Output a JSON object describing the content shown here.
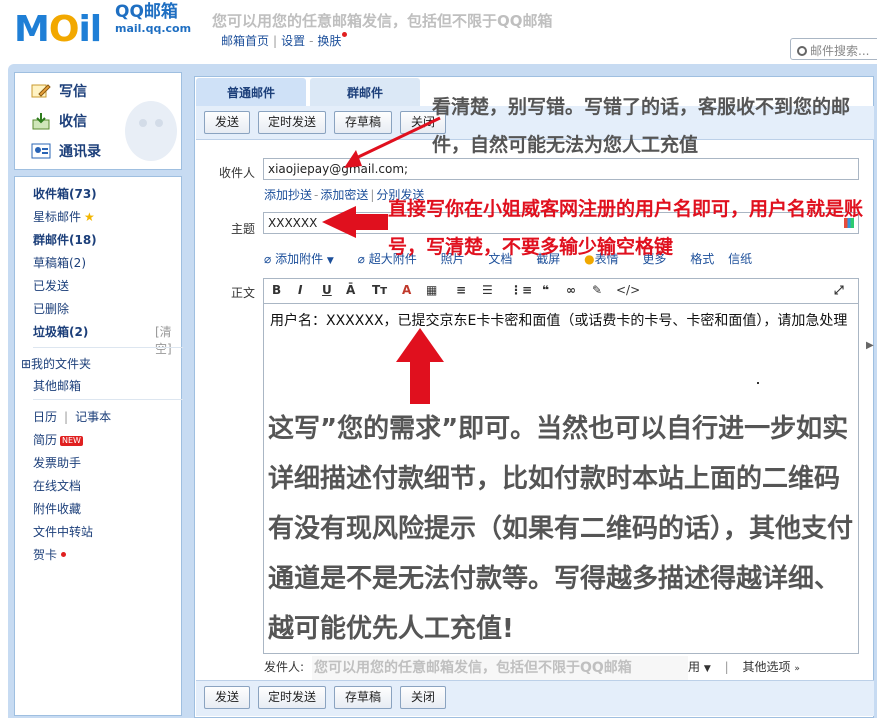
{
  "header": {
    "logo_text": "MOil",
    "logo_cn": "QQ邮箱",
    "logo_url": "mail.qq.com",
    "slogan": "您可以用您的任意邮箱发信，包括但不限于QQ邮箱",
    "nav_home": "邮箱首页",
    "nav_settings": "设置",
    "nav_skin": "换肤",
    "search_placeholder": "邮件搜索..."
  },
  "quick": {
    "compose": "写信",
    "inbox": "收信",
    "contacts": "通讯录"
  },
  "sidebar": {
    "items": [
      {
        "label": "收件箱(73)"
      },
      {
        "label": "星标邮件"
      },
      {
        "label": "群邮件(18)"
      },
      {
        "label": "草稿箱(2)"
      },
      {
        "label": "已发送"
      },
      {
        "label": "已删除"
      },
      {
        "label": "垃圾箱(2)"
      }
    ],
    "clear": "[清空]",
    "my_folders": "⊞我的文件夹",
    "other_mailbox": "其他邮箱",
    "calendar": "日历",
    "notes": "记事本",
    "resume": "简历",
    "new_badge": "NEW",
    "invoice": "发票助手",
    "docs": "在线文档",
    "attach_fav": "附件收藏",
    "transfer": "文件中转站",
    "card": "贺卡"
  },
  "tabs": {
    "normal": "普通邮件",
    "group": "群邮件"
  },
  "toolbar": {
    "send": "发送",
    "timed_send": "定时发送",
    "save_draft": "存草稿",
    "close": "关闭"
  },
  "compose": {
    "to_label": "收件人",
    "to_value": "xiaojiepay@gmail.com;",
    "add_cc": "添加抄送",
    "add_bcc": "添加密送",
    "split_send": "分别发送",
    "subject_label": "主题",
    "subject_value": "XXXXXX",
    "attach": "添加附件",
    "super_attach": "超大附件",
    "photo": "照片",
    "doc": "文档",
    "screenshot": "截屏",
    "emoji": "表情",
    "more": "更多",
    "format": "格式",
    "letter": "信纸",
    "body_label": "正文",
    "body_text": "用户名：XXXXXX，已提交京东E卡卡密和面值（或话费卡的卡号、卡密和面值），请加急处理",
    "sender_label": "发件人:",
    "sender_slogan": "您可以用您的任意邮箱发信，包括但不限于QQ邮箱",
    "sender_use": "用",
    "other_options": "其他选项"
  },
  "editor_tools": [
    "B",
    "I",
    "U",
    "Ā",
    "Tт",
    "A",
    "▦",
    "≡",
    "☰",
    "⋮≡",
    "❝",
    "∞",
    "✎",
    "</>",
    "⤢"
  ],
  "annotations": {
    "top_note": "看清楚，别写错。写错了的话，客服收不到您的邮件，自然可能无法为您人工充值",
    "subject_note": "直接写你在小姐威客网注册的用户名即可，用户名就是账号，写清楚，不要多输少输空格键",
    "body_note": "这写”您的需求”即可。当然也可以自行进一步如实详细描述付款细节，比如付款时本站上面的二维码有没有现风险提示（如果有二维码的话），其他支付通道是不是无法付款等。写得越多描述得越详细、越可能优先人工充值!"
  },
  "colors": {
    "brand_blue": "#1f7fd6",
    "frame_blue": "#c7dbf2",
    "annotation_red": "#e0101e"
  }
}
